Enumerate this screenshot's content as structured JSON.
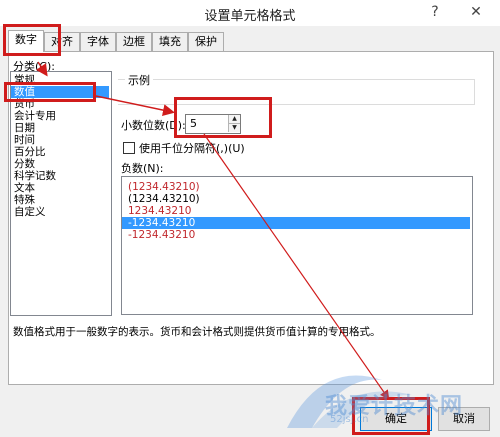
{
  "window": {
    "title": "设置单元格格式",
    "help_glyph": "?",
    "close_glyph": "✕"
  },
  "tabs": [
    {
      "label": "数字",
      "active": true
    },
    {
      "label": "对齐",
      "active": false
    },
    {
      "label": "字体",
      "active": false
    },
    {
      "label": "边框",
      "active": false
    },
    {
      "label": "填充",
      "active": false
    },
    {
      "label": "保护",
      "active": false
    }
  ],
  "category": {
    "label": "分类(C):",
    "items": [
      "常规",
      "数值",
      "货币",
      "会计专用",
      "日期",
      "时间",
      "百分比",
      "分数",
      "科学记数",
      "文本",
      "特殊",
      "自定义"
    ],
    "selected_index": 1
  },
  "sample": {
    "label": "示例",
    "value": ""
  },
  "decimal_places": {
    "label": "小数位数(D):",
    "value": "5"
  },
  "thousands_separator": {
    "label": "使用千位分隔符(,)(U)",
    "checked": false
  },
  "negative_numbers": {
    "label": "负数(N):",
    "items": [
      {
        "text": "(1234.43210)",
        "color": "#c0282d"
      },
      {
        "text": "(1234.43210)",
        "color": "#000000"
      },
      {
        "text": "1234.43210",
        "color": "#c0282d"
      },
      {
        "text": "-1234.43210",
        "color": "#ffffff"
      },
      {
        "text": "-1234.43210",
        "color": "#c0282d"
      }
    ],
    "selected_index": 3
  },
  "description": "数值格式用于一般数字的表示。货币和会计格式则提供货币值计算的专用格式。",
  "buttons": {
    "ok": "确定",
    "cancel": "取消"
  },
  "watermark": {
    "text": "我爱计技术网",
    "url": "52jsj.cn"
  },
  "colors": {
    "highlight": "#d01c1c",
    "selection": "#3399ff",
    "negative_red": "#c0282d"
  }
}
